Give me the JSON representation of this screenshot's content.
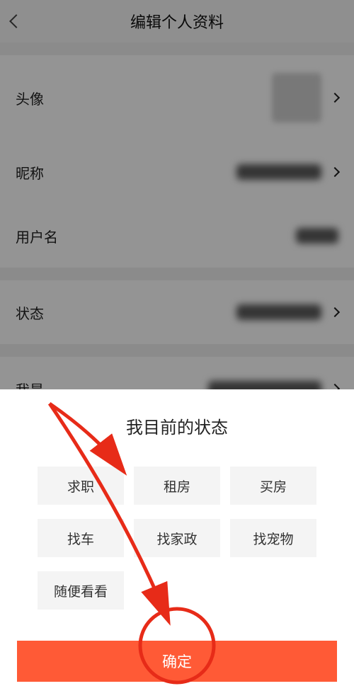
{
  "header": {
    "title": "编辑个人资料"
  },
  "rows": {
    "avatar_label": "头像",
    "nickname_label": "昵称",
    "username_label": "用户名",
    "status_label": "状态",
    "iam_label": "我是"
  },
  "sheet": {
    "title": "我目前的状态",
    "options": [
      "求职",
      "租房",
      "买房",
      "找车",
      "找家政",
      "找宠物",
      "随便看看"
    ],
    "confirm": "确定"
  },
  "colors": {
    "accent": "#ff5a36"
  }
}
